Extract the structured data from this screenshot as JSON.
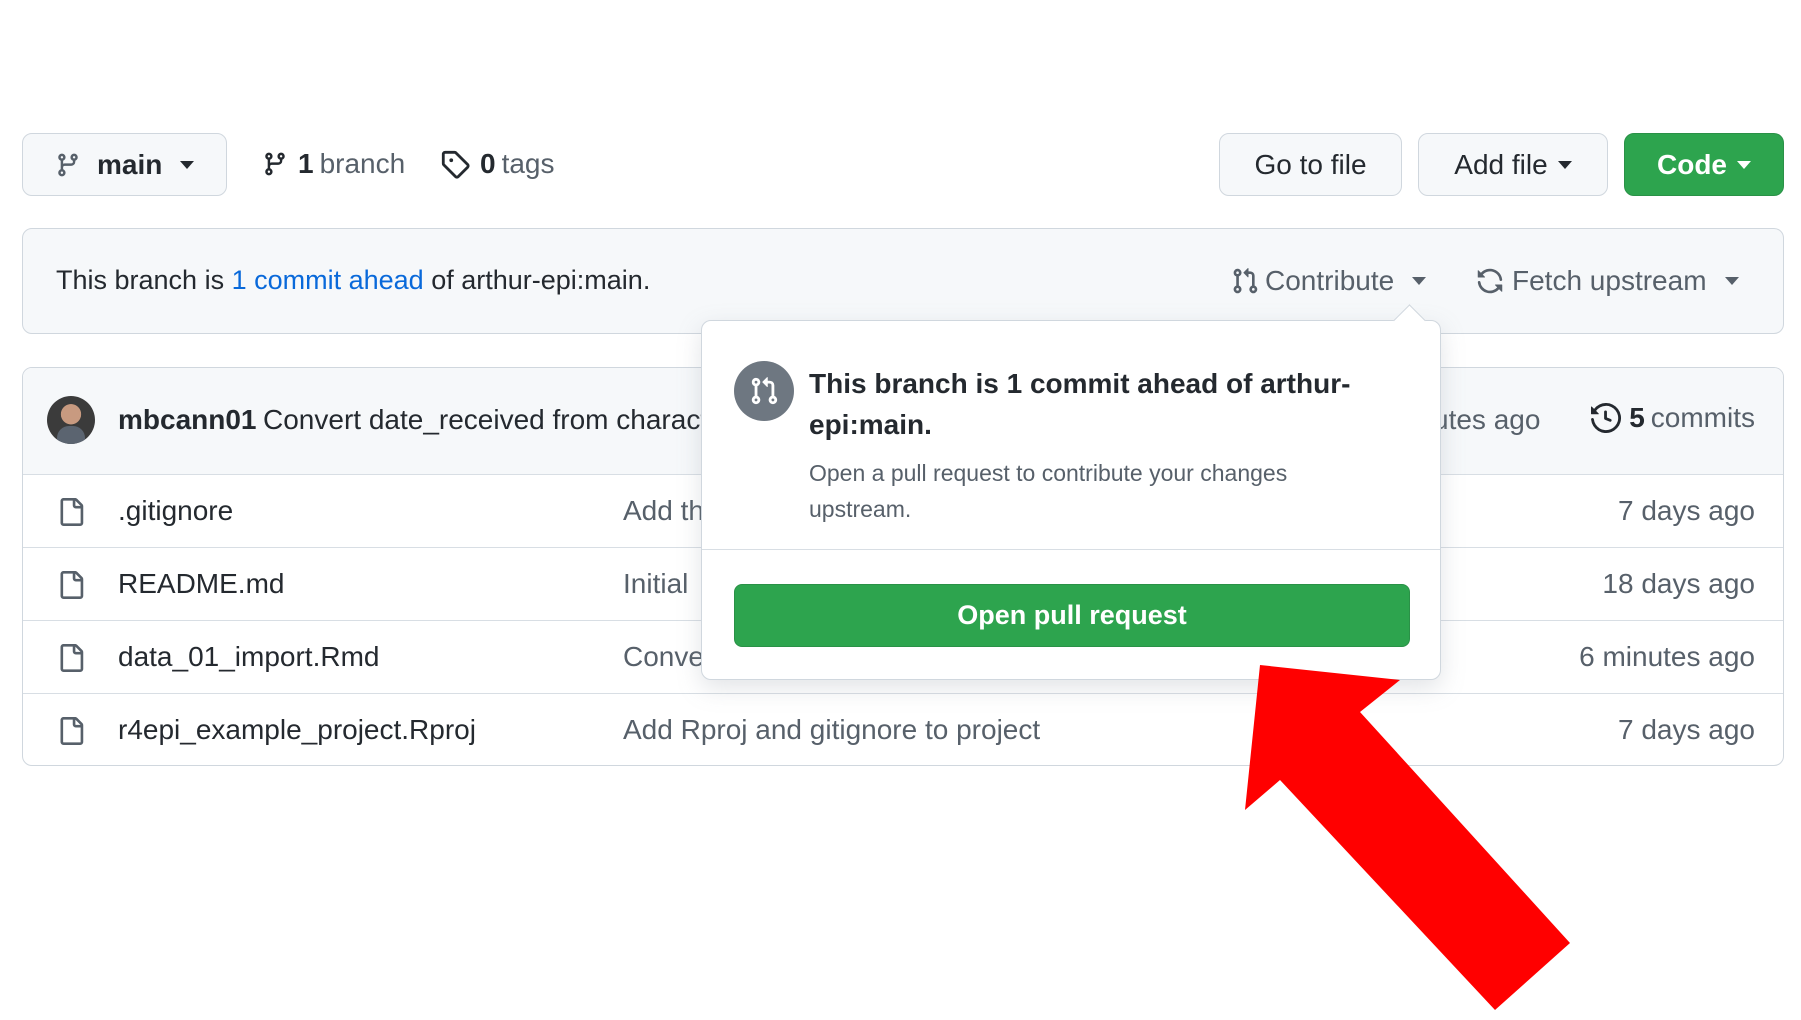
{
  "toolbar": {
    "branch_select": {
      "label": "main"
    },
    "branches": {
      "count": "1",
      "label": "branch"
    },
    "tags": {
      "count": "0",
      "label": "tags"
    },
    "go_to_file_label": "Go to file",
    "add_file_label": "Add file",
    "code_label": "Code"
  },
  "banner": {
    "text_prefix": "This branch is",
    "link_text": "1 commit ahead",
    "text_suffix": "of arthur-epi:main.",
    "contribute_label": "Contribute",
    "fetch_label": "Fetch upstream"
  },
  "latest_commit": {
    "author": "mbcann01",
    "message": "Convert date_received from character",
    "time": "utes ago",
    "commits_count": "5",
    "commits_label": "commits"
  },
  "files": [
    {
      "name": ".gitignore",
      "message": "Add the",
      "time": "7 days ago"
    },
    {
      "name": "README.md",
      "message": "Initial",
      "time": "18 days ago"
    },
    {
      "name": "data_01_import.Rmd",
      "message": "Conve",
      "time": "6 minutes ago"
    },
    {
      "name": "r4epi_example_project.Rproj",
      "message": "Add Rproj and gitignore to project",
      "time": "7 days ago"
    }
  ],
  "popover": {
    "title": "This branch is 1 commit ahead of arthur-epi:main.",
    "description": "Open a pull request to contribute your changes upstream.",
    "button_label": "Open pull request"
  },
  "colors": {
    "primary_green": "#2da44e",
    "link_blue": "#0969da",
    "annotation_red": "#ff0000"
  },
  "icons": [
    "branch-icon",
    "tag-icon",
    "pull-request-icon",
    "sync-icon",
    "history-icon",
    "file-icon",
    "caret-down-icon"
  ]
}
